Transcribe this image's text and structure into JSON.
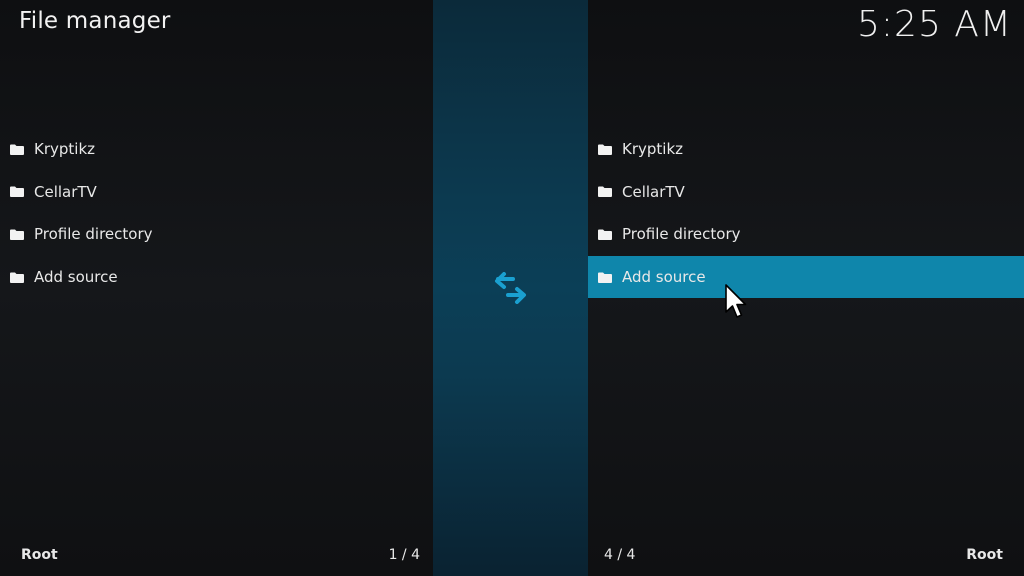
{
  "header": {
    "title": "File manager",
    "time": "5:25 AM"
  },
  "left_pane": {
    "items": [
      {
        "label": " Kryptikz",
        "icon": "folder-icon"
      },
      {
        "label": "CellarTV",
        "icon": "folder-icon"
      },
      {
        "label": "Profile directory",
        "icon": "folder-icon"
      },
      {
        "label": "Add source",
        "icon": "folder-icon"
      }
    ],
    "path": "Root",
    "position": "1 / 4"
  },
  "right_pane": {
    "items": [
      {
        "label": " Kryptikz",
        "icon": "folder-icon"
      },
      {
        "label": "CellarTV",
        "icon": "folder-icon"
      },
      {
        "label": "Profile directory",
        "icon": "folder-icon"
      },
      {
        "label": "Add source",
        "icon": "folder-icon",
        "selected": true
      }
    ],
    "path": "Root",
    "position": "4 / 4"
  },
  "center": {
    "icon": "swap-arrows-icon"
  },
  "colors": {
    "accent": "#0f86ab",
    "swap_icon": "#1aa0d0",
    "background": "#111214"
  }
}
